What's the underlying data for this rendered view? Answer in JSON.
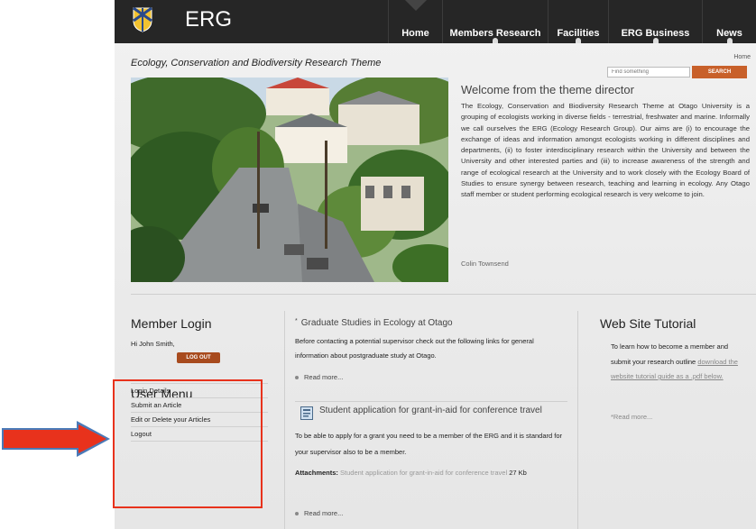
{
  "site": {
    "name": "ERG",
    "tagline": "Ecology, Conservation and Biodiversity Research Theme"
  },
  "nav": {
    "items": [
      "Home",
      "Members Research",
      "Facilities",
      "ERG Business",
      "News"
    ]
  },
  "breadcrumb": "Home",
  "search": {
    "placeholder": "Find something",
    "button_label": "SEARCH"
  },
  "welcome": {
    "title": "Welcome from the theme director",
    "body": "The Ecology, Conservation and Biodiversity Research Theme at Otago University is a grouping of ecologists working in diverse fields - terrestrial, freshwater and marine. Informally we call ourselves the ERG (Ecology Research Group). Our aims are (i) to encourage the exchange of ideas and information amongst ecologists working in different disciplines and departments, (ii) to foster interdisciplinary research within the University and between the University and other interested parties and (iii) to increase awareness of the strength and range of ecological research at the University and to work closely with the Ecology Board of Studies to ensure synergy between research, teaching and learning in ecology. Any Otago staff member or student performing ecological research is very welcome to join.",
    "signature": "Colin Townsend"
  },
  "login": {
    "title": "Member Login",
    "greeting": "Hi John Smith,",
    "logout_label": "LOG OUT"
  },
  "user_menu": {
    "title": "User Menu",
    "items": [
      "Login Details",
      "Submit an Article",
      "Edit or Delete your Articles",
      "Logout"
    ]
  },
  "articles": [
    {
      "title": "Graduate Studies in Ecology at Otago",
      "body": "Before contacting a potential supervisor check out the following links for general information about postgraduate study at Otago.",
      "read_more": "Read more..."
    },
    {
      "title": "Student application for grant-in-aid for conference travel",
      "body": "To be able to apply for a grant you need to be a member of the ERG and it is standard for your supervisor also to be a member.",
      "attachments_label": "Attachments:",
      "attachment_name": "Student application for grant-in-aid for conference travel",
      "attachment_size": "27 Kb",
      "read_more": "Read more..."
    }
  ],
  "tutorial": {
    "title": "Web Site Tutorial",
    "body": "To learn how to become a member and submit your research outline",
    "link": "download the website tutorial guide as a .pdf below.",
    "read_more": "*Read more..."
  },
  "colors": {
    "topbar": "#262626",
    "accent": "#c8602a",
    "highlight": "#e8321c",
    "arrow": "#e8321c"
  }
}
